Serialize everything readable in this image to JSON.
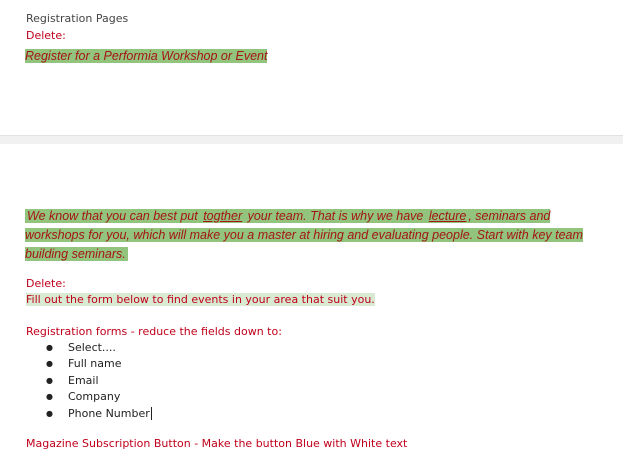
{
  "header": {
    "title": "Registration Pages",
    "delete_label": "Delete:",
    "highlighted_line": "Register for a Performia Workshop or Event"
  },
  "body": {
    "paragraph": {
      "part1": "We know that you can best put ",
      "underlined1": "togther",
      "part2": " your team. That is why we have ",
      "underlined2": "lecture",
      "part3": ", seminars and workshops for you, which will make you a master at hiring and evaluating people. Start with key team building seminars."
    },
    "delete_label": "Delete:",
    "fill_out_text": "Fill out the form below to find events in your area that suit you.",
    "forms_heading": "Registration forms - reduce the fields down to:",
    "fields": [
      "Select....",
      "Full name",
      "Email",
      "Company",
      "Phone Number"
    ],
    "magazine_note": "Magazine Subscription Button - Make the button Blue with White text"
  },
  "colors": {
    "highlight_green": "#93c47d",
    "highlight_light": "#d9ead3",
    "text_red": "#c0001a"
  }
}
